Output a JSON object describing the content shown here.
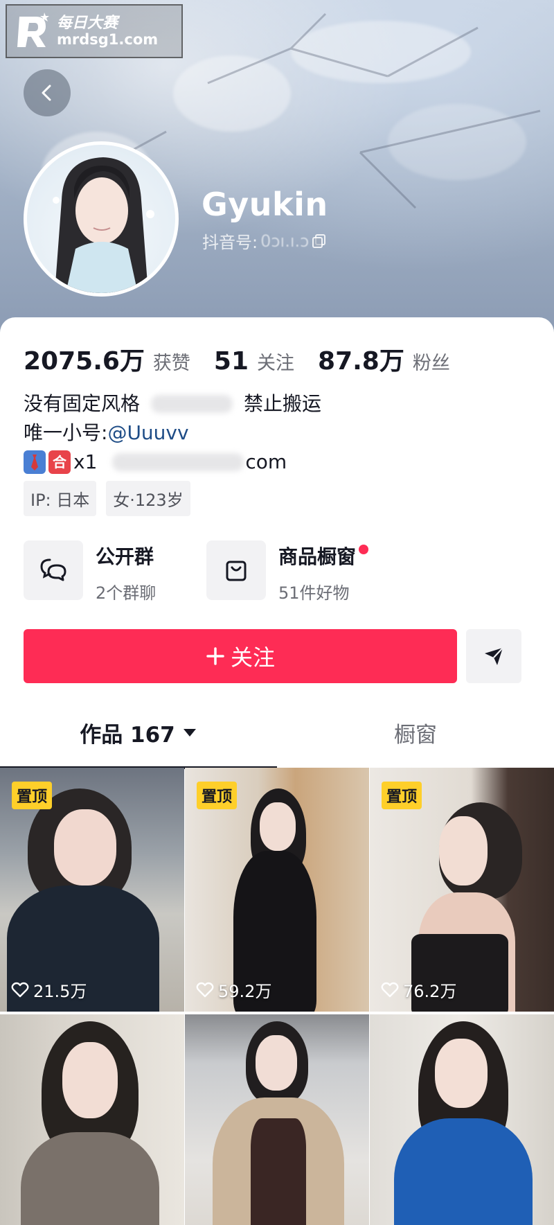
{
  "watermark": {
    "title": "每日大赛",
    "url": "mrdsg1.com"
  },
  "profile": {
    "nickname": "Gyukin",
    "douyin_id_label": "抖音号:",
    "douyin_id_value": "0ɔı.ı.ɔ"
  },
  "stats": [
    {
      "num": "2075.6万",
      "label": "获赞"
    },
    {
      "num": "51",
      "label": "关注"
    },
    {
      "num": "87.8万",
      "label": "粉丝"
    }
  ],
  "bio": {
    "line1_start": "没有固定风格",
    "line1_end": "禁止搬运",
    "line2_prefix": " 唯一小号: ",
    "line2_link": "@Uuuvv",
    "line3_badge": "合",
    "line3_prefix": "x1",
    "line3_suffix": "com"
  },
  "tags": [
    "IP: 日本",
    "女·123岁"
  ],
  "entries": [
    {
      "title": "公开群",
      "sub": "2个群聊",
      "icon": "chat-bubbles-icon"
    },
    {
      "title": "商品橱窗",
      "sub": "51件好物",
      "icon": "shopping-bag-icon"
    }
  ],
  "actions": {
    "follow_label": "关注",
    "share_icon": "send-icon"
  },
  "tabs": {
    "works_label": "作品 167",
    "shop_label": "橱窗"
  },
  "videos": [
    {
      "pinned": "置顶",
      "likes": "21.5万"
    },
    {
      "pinned": "置顶",
      "likes": "59.2万"
    },
    {
      "pinned": "置顶",
      "likes": "76.2万"
    },
    {
      "pinned": "",
      "likes": ""
    },
    {
      "pinned": "",
      "likes": ""
    },
    {
      "pinned": "",
      "likes": ""
    }
  ],
  "colors": {
    "accent": "#fe2c55",
    "pin": "#fecf2a",
    "link": "#1e4c86"
  }
}
